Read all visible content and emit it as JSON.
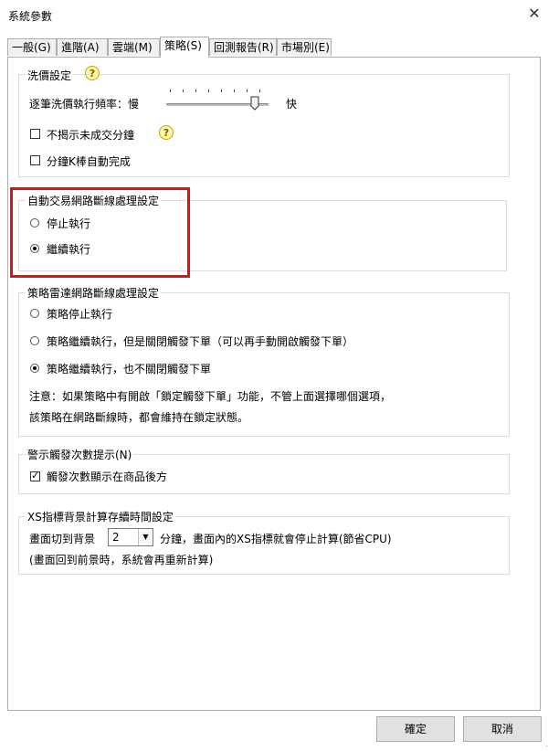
{
  "window": {
    "title": "系統參數",
    "close_glyph": "✕"
  },
  "tabs": [
    {
      "label": "一般(G)",
      "active": false
    },
    {
      "label": "進階(A)",
      "active": false
    },
    {
      "label": "雲端(M)",
      "active": false
    },
    {
      "label": "策略(S)",
      "active": true
    },
    {
      "label": "回測報告(R)",
      "active": false
    },
    {
      "label": "市場別(E)",
      "active": false
    }
  ],
  "wash": {
    "legend": "洗價設定",
    "freq_label": "逐筆洗價執行頻率：慢",
    "fast_label": "快",
    "slider_level": 0.9,
    "hide_unfilled_label": "不揭示未成交分鐘",
    "hide_unfilled_checked": false,
    "auto_complete_label": "分鐘K棒自動完成",
    "auto_complete_checked": false,
    "help_glyph": "?"
  },
  "auto_trade": {
    "legend": "自動交易網路斷線處理設定",
    "options": [
      {
        "label": "停止執行",
        "checked": false
      },
      {
        "label": "繼續執行",
        "checked": true
      }
    ]
  },
  "radar": {
    "legend": "策略雷達網路斷線處理設定",
    "options": [
      {
        "label": "策略停止執行",
        "checked": false
      },
      {
        "label": "策略繼續執行，但是關閉觸發下單（可以再手動開啟觸發下單）",
        "checked": false
      },
      {
        "label": "策略繼續執行，也不關閉觸發下單",
        "checked": true
      }
    ],
    "note_line1": "注意：如果策略中有開啟「鎖定觸發下單」功能，不管上面選擇哪個選項，",
    "note_line2": "該策略在網路斷線時，都會維持在鎖定狀態。"
  },
  "alert": {
    "legend": "警示觸發次數提示(N)",
    "show_count_label": "觸發次數顯示在商品後方",
    "show_count_checked": true
  },
  "xs": {
    "legend": "XS指標背景計算存續時間設定",
    "prefix": "畫面切到背景",
    "minutes_value": "2",
    "suffix": "分鐘，畫面內的XS指標就會停止計算(節省CPU)",
    "note": "(畫面回到前景時，系統會再重新計算)"
  },
  "buttons": {
    "ok": "確定",
    "cancel": "取消"
  },
  "colors": {
    "highlight": "#e01010"
  }
}
